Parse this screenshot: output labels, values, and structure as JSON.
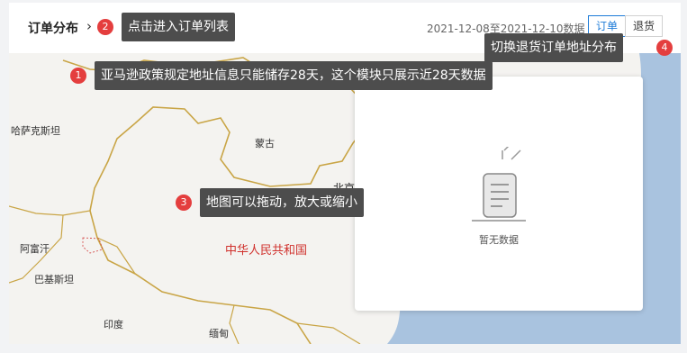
{
  "header": {
    "title": "订单分布",
    "date_range": "2021-12-08至2021-12-10数据",
    "tabs": [
      {
        "label": "订单",
        "active": true
      },
      {
        "label": "退货",
        "active": false
      }
    ]
  },
  "map": {
    "labels": {
      "kazakhstan": "哈萨克斯坦",
      "mongolia": "蒙古",
      "beijing": "北京",
      "afghanistan": "阿富汗",
      "pakistan": "巴基斯坦",
      "india": "印度",
      "myanmar": "缅甸",
      "china": "中华人民共和国"
    },
    "empty_text": "暂无数据"
  },
  "annotations": [
    {
      "number": "1",
      "text": "亚马逊政策规定地址信息只能储存28天，这个模块只展示近28天数据"
    },
    {
      "number": "2",
      "text": "点击进入订单列表"
    },
    {
      "number": "3",
      "text": "地图可以拖动，放大或缩小"
    },
    {
      "number": "4",
      "text": "切换退货订单地址分布"
    }
  ],
  "colors": {
    "accent": "#1d7bd8",
    "badge": "#e43e3e",
    "tooltip": "#4d4d4d",
    "sea": "#a9c3df",
    "border": "#c9a546"
  }
}
